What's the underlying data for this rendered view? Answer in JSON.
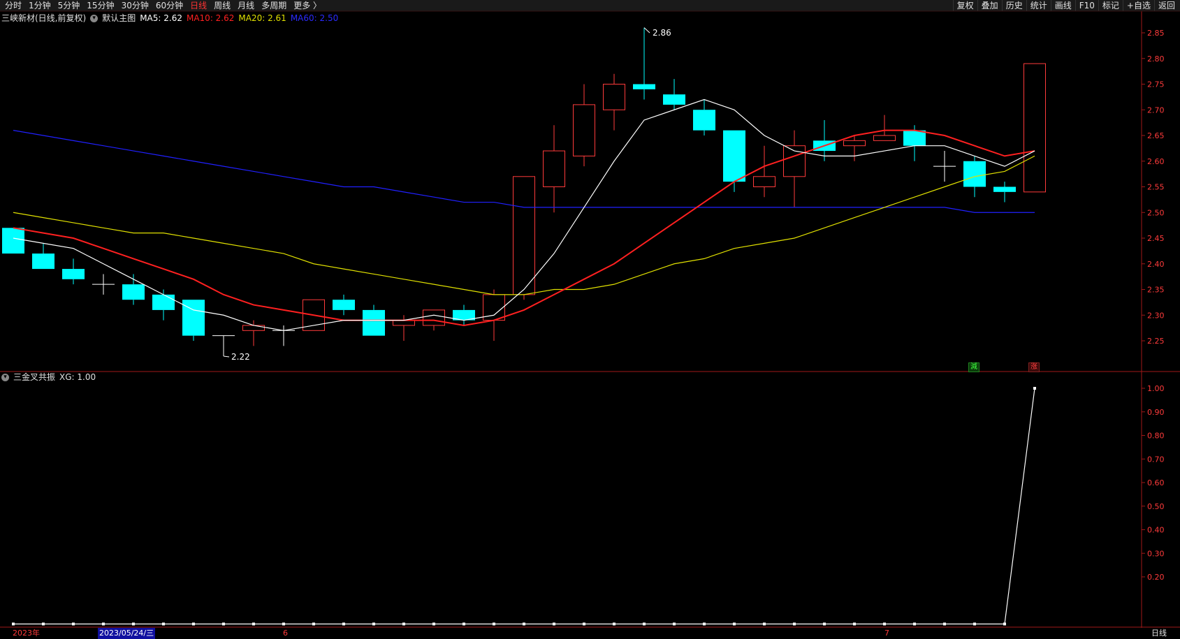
{
  "toolbar": {
    "periods": [
      "分时",
      "1分钟",
      "5分钟",
      "15分钟",
      "30分钟",
      "60分钟",
      "日线",
      "周线",
      "月线",
      "多周期",
      "更多 〉"
    ],
    "active_period": "日线",
    "actions": [
      "复权",
      "叠加",
      "历史",
      "统计",
      "画线",
      "F10",
      "标记",
      "+自选",
      "返回"
    ]
  },
  "main_legend": {
    "title": "三峡新材(日线,前复权)",
    "template": "默认主图",
    "ma5": "MA5: 2.62",
    "ma10": "MA10: 2.62",
    "ma20": "MA20: 2.61",
    "ma60": "MA60: 2.50"
  },
  "sub_legend": {
    "title": "三金叉共振",
    "xg": "XG: 1.00"
  },
  "labels": {
    "high": "2.86",
    "low": "2.22",
    "tag_reduce": "減",
    "tag_rise": "涨"
  },
  "bottom_axis": {
    "year": "2023年",
    "cursor_date": "2023/05/24/三",
    "month6": "6",
    "month7": "7",
    "period_label": "日线"
  },
  "colors": {
    "up": "#ff3b3b",
    "down": "#00ffff",
    "ma5": "#ffffff",
    "ma10": "#ff2020",
    "ma20": "#e0e000",
    "ma60": "#2020ff",
    "axis": "#ff3b3b"
  },
  "chart_data": [
    {
      "type": "candlestick",
      "title": "三峡新材(日线,前复权)",
      "ylim": [
        2.2,
        2.88
      ],
      "yticks": [
        2.25,
        2.3,
        2.35,
        2.4,
        2.45,
        2.5,
        2.55,
        2.6,
        2.65,
        2.7,
        2.75,
        2.8,
        2.85
      ],
      "candles": [
        {
          "o": 2.47,
          "h": 2.47,
          "l": 2.42,
          "c": 2.42
        },
        {
          "o": 2.42,
          "h": 2.44,
          "l": 2.39,
          "c": 2.39
        },
        {
          "o": 2.39,
          "h": 2.41,
          "l": 2.36,
          "c": 2.37
        },
        {
          "o": 2.36,
          "h": 2.38,
          "l": 2.34,
          "c": 2.36
        },
        {
          "o": 2.36,
          "h": 2.38,
          "l": 2.32,
          "c": 2.33
        },
        {
          "o": 2.34,
          "h": 2.35,
          "l": 2.29,
          "c": 2.31
        },
        {
          "o": 2.33,
          "h": 2.33,
          "l": 2.25,
          "c": 2.26
        },
        {
          "o": 2.26,
          "h": 2.26,
          "l": 2.22,
          "c": 2.26
        },
        {
          "o": 2.27,
          "h": 2.29,
          "l": 2.24,
          "c": 2.28
        },
        {
          "o": 2.27,
          "h": 2.28,
          "l": 2.24,
          "c": 2.27
        },
        {
          "o": 2.27,
          "h": 2.33,
          "l": 2.27,
          "c": 2.33
        },
        {
          "o": 2.33,
          "h": 2.34,
          "l": 2.3,
          "c": 2.31
        },
        {
          "o": 2.31,
          "h": 2.32,
          "l": 2.26,
          "c": 2.26
        },
        {
          "o": 2.28,
          "h": 2.3,
          "l": 2.25,
          "c": 2.29
        },
        {
          "o": 2.28,
          "h": 2.31,
          "l": 2.27,
          "c": 2.31
        },
        {
          "o": 2.31,
          "h": 2.32,
          "l": 2.28,
          "c": 2.29
        },
        {
          "o": 2.29,
          "h": 2.35,
          "l": 2.25,
          "c": 2.34
        },
        {
          "o": 2.34,
          "h": 2.57,
          "l": 2.33,
          "c": 2.57
        },
        {
          "o": 2.55,
          "h": 2.67,
          "l": 2.5,
          "c": 2.62
        },
        {
          "o": 2.61,
          "h": 2.75,
          "l": 2.59,
          "c": 2.71
        },
        {
          "o": 2.7,
          "h": 2.77,
          "l": 2.66,
          "c": 2.75
        },
        {
          "o": 2.75,
          "h": 2.86,
          "l": 2.72,
          "c": 2.74
        },
        {
          "o": 2.73,
          "h": 2.76,
          "l": 2.7,
          "c": 2.71
        },
        {
          "o": 2.7,
          "h": 2.72,
          "l": 2.65,
          "c": 2.66
        },
        {
          "o": 2.66,
          "h": 2.66,
          "l": 2.54,
          "c": 2.56
        },
        {
          "o": 2.55,
          "h": 2.63,
          "l": 2.53,
          "c": 2.57
        },
        {
          "o": 2.57,
          "h": 2.66,
          "l": 2.51,
          "c": 2.63
        },
        {
          "o": 2.64,
          "h": 2.68,
          "l": 2.6,
          "c": 2.62
        },
        {
          "o": 2.63,
          "h": 2.65,
          "l": 2.6,
          "c": 2.64
        },
        {
          "o": 2.64,
          "h": 2.69,
          "l": 2.64,
          "c": 2.65
        },
        {
          "o": 2.66,
          "h": 2.67,
          "l": 2.6,
          "c": 2.63
        },
        {
          "o": 2.59,
          "h": 2.62,
          "l": 2.56,
          "c": 2.59
        },
        {
          "o": 2.6,
          "h": 2.61,
          "l": 2.53,
          "c": 2.55
        },
        {
          "o": 2.55,
          "h": 2.56,
          "l": 2.52,
          "c": 2.54
        },
        {
          "o": 2.54,
          "h": 2.79,
          "l": 2.54,
          "c": 2.79
        }
      ],
      "ma5": [
        2.45,
        2.44,
        2.43,
        2.4,
        2.37,
        2.34,
        2.31,
        2.3,
        2.28,
        2.27,
        2.28,
        2.29,
        2.29,
        2.29,
        2.3,
        2.29,
        2.3,
        2.35,
        2.42,
        2.51,
        2.6,
        2.68,
        2.7,
        2.72,
        2.7,
        2.65,
        2.62,
        2.61,
        2.61,
        2.62,
        2.63,
        2.63,
        2.61,
        2.59,
        2.62
      ],
      "ma10": [
        2.47,
        2.46,
        2.45,
        2.43,
        2.41,
        2.39,
        2.37,
        2.34,
        2.32,
        2.31,
        2.3,
        2.29,
        2.29,
        2.29,
        2.29,
        2.28,
        2.29,
        2.31,
        2.34,
        2.37,
        2.4,
        2.44,
        2.48,
        2.52,
        2.56,
        2.59,
        2.61,
        2.63,
        2.65,
        2.66,
        2.66,
        2.65,
        2.63,
        2.61,
        2.62
      ],
      "ma20": [
        2.5,
        2.49,
        2.48,
        2.47,
        2.46,
        2.46,
        2.45,
        2.44,
        2.43,
        2.42,
        2.4,
        2.39,
        2.38,
        2.37,
        2.36,
        2.35,
        2.34,
        2.34,
        2.35,
        2.35,
        2.36,
        2.38,
        2.4,
        2.41,
        2.43,
        2.44,
        2.45,
        2.47,
        2.49,
        2.51,
        2.53,
        2.55,
        2.57,
        2.58,
        2.61
      ],
      "ma60": [
        2.66,
        2.65,
        2.64,
        2.63,
        2.62,
        2.61,
        2.6,
        2.59,
        2.58,
        2.57,
        2.56,
        2.55,
        2.55,
        2.54,
        2.53,
        2.52,
        2.52,
        2.51,
        2.51,
        2.51,
        2.51,
        2.51,
        2.51,
        2.51,
        2.51,
        2.51,
        2.51,
        2.51,
        2.51,
        2.51,
        2.51,
        2.51,
        2.5,
        2.5,
        2.5
      ]
    },
    {
      "type": "line",
      "title": "三金叉共振",
      "ylim": [
        0.0,
        1.05
      ],
      "yticks": [
        0.2,
        0.3,
        0.4,
        0.5,
        0.6,
        0.7,
        0.8,
        0.9,
        1.0
      ],
      "series": [
        {
          "name": "XG",
          "values": [
            0,
            0,
            0,
            0,
            0,
            0,
            0,
            0,
            0,
            0,
            0,
            0,
            0,
            0,
            0,
            0,
            0,
            0,
            0,
            0,
            0,
            0,
            0,
            0,
            0,
            0,
            0,
            0,
            0,
            0,
            0,
            0,
            0,
            0,
            1
          ]
        }
      ]
    }
  ]
}
